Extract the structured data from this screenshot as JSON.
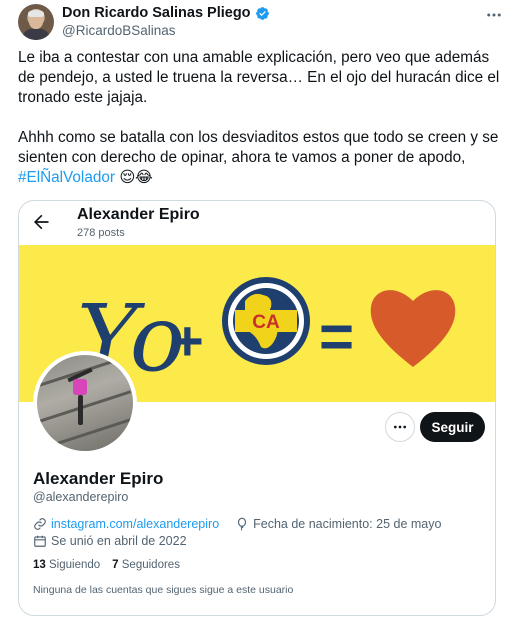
{
  "author": {
    "display_name": "Don Ricardo Salinas Pliego",
    "handle": "@RicardoBSalinas",
    "verified": true
  },
  "tweet": {
    "paragraph_1": "Le iba a contestar con una amable explicación, pero veo que además de pendejo, a usted le truena la reversa… En el ojo del huracán dice el tronado este jajaja.",
    "paragraph_2_text": "Ahhh como se batalla con los desviaditos estos que todo se creen y se sienten con derecho de opinar, ahora te vamos a poner de apodo, ",
    "hashtag": "#ElÑalVolador",
    "emojis": "😌😂"
  },
  "embedded_profile": {
    "title": "Alexander Epiro",
    "posts_count": "278 posts",
    "banner_text_yo": "Yo",
    "banner_plus": "+",
    "banner_equals": "=",
    "banner_logo_letters": "CA",
    "banner_color": "#fbea4a",
    "name": "Alexander Epiro",
    "handle": "@alexanderepiro",
    "website": "instagram.com/alexanderepiro",
    "birthday": "Fecha de nacimiento: 25 de mayo",
    "joined": "Se unió en abril de 2022",
    "following_count": "13",
    "following_label": "Siguiendo",
    "followers_count": "7",
    "followers_label": "Seguidores",
    "footnote": "Ninguna de las cuentas que sigues sigue a este usuario",
    "follow_button": "Seguir"
  },
  "colors": {
    "accent": "#1d9bf0",
    "text": "#0f1419",
    "muted": "#536471",
    "heart": "#d75a2b"
  }
}
